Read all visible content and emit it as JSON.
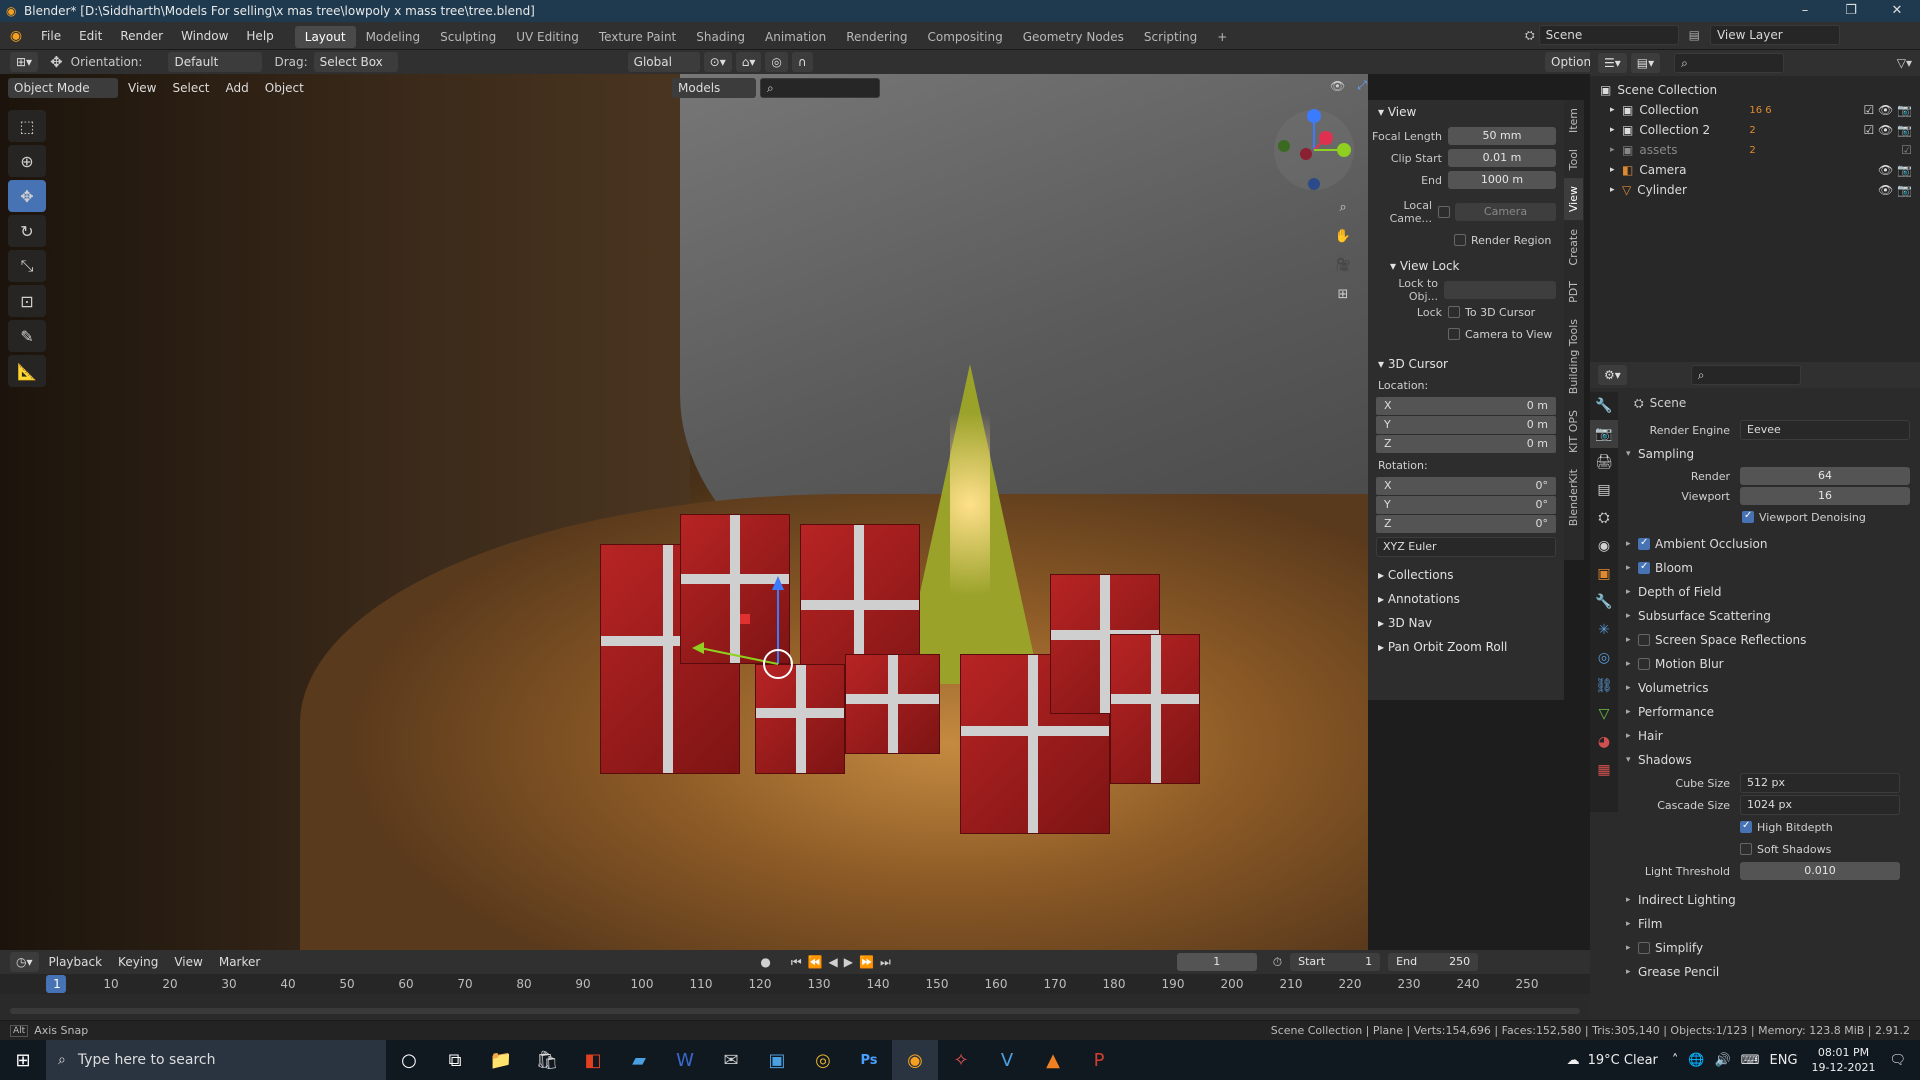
{
  "window": {
    "title": "Blender* [D:\\Siddharth\\Models For selling\\x mas tree\\lowpoly x mass tree\\tree.blend]",
    "controls": [
      "–",
      "❐",
      "✕"
    ]
  },
  "menubar": {
    "menus": [
      "File",
      "Edit",
      "Render",
      "Window",
      "Help"
    ],
    "workspaces": [
      "Layout",
      "Modeling",
      "Sculpting",
      "UV Editing",
      "Texture Paint",
      "Shading",
      "Animation",
      "Rendering",
      "Compositing",
      "Geometry Nodes",
      "Scripting",
      "+"
    ],
    "active_workspace": "Layout",
    "scene": "Scene",
    "view_layer": "View Layer"
  },
  "toolheader": {
    "orientation_label": "Orientation:",
    "orientation_value": "Default",
    "drag_label": "Drag:",
    "drag_value": "Select Box",
    "transform_space": "Global",
    "options": "Options"
  },
  "viewport_header": {
    "mode": "Object Mode",
    "menus": [
      "View",
      "Select",
      "Add",
      "Object"
    ],
    "collection_filter": "Models"
  },
  "npanel": {
    "tabs": [
      "Item",
      "Tool",
      "View",
      "Create",
      "PDT",
      "Building Tools",
      "KIT OPS",
      "BlenderKit"
    ],
    "active_tab": "View",
    "view": {
      "header": "View",
      "focal_length_label": "Focal Length",
      "focal_length": "50 mm",
      "clip_start_label": "Clip Start",
      "clip_start": "0.01 m",
      "end_label": "End",
      "end": "1000 m",
      "local_camera_label": "Local Came...",
      "local_camera_value": "Camera",
      "render_region": "Render Region"
    },
    "view_lock": {
      "header": "View Lock",
      "lock_to_obj_label": "Lock to Obj...",
      "lock_label": "Lock",
      "to_3d_cursor": "To 3D Cursor",
      "camera_to_view": "Camera to View"
    },
    "cursor": {
      "header": "3D Cursor",
      "location_label": "Location:",
      "loc": [
        {
          "axis": "X",
          "value": "0 m"
        },
        {
          "axis": "Y",
          "value": "0 m"
        },
        {
          "axis": "Z",
          "value": "0 m"
        }
      ],
      "rotation_label": "Rotation:",
      "rot": [
        {
          "axis": "X",
          "value": "0°"
        },
        {
          "axis": "Y",
          "value": "0°"
        },
        {
          "axis": "Z",
          "value": "0°"
        }
      ],
      "rotation_mode": "XYZ Euler"
    },
    "collapsed": [
      "Collections",
      "Annotations",
      "3D Nav",
      "Pan Orbit Zoom Roll"
    ]
  },
  "outliner": {
    "root": "Scene Collection",
    "items": [
      {
        "name": "Collection",
        "badges": "16 6"
      },
      {
        "name": "Collection 2",
        "badges": "2"
      },
      {
        "name": "assets",
        "badges": "2"
      },
      {
        "name": "Camera",
        "badges": ""
      },
      {
        "name": "Cylinder",
        "badges": ""
      }
    ]
  },
  "properties": {
    "scene_label": "Scene",
    "render_engine_label": "Render Engine",
    "render_engine": "Eevee",
    "sampling": {
      "header": "Sampling",
      "render_label": "Render",
      "render": "64",
      "viewport_label": "Viewport",
      "viewport": "16",
      "denoise": "Viewport Denoising"
    },
    "sections": [
      {
        "label": "Ambient Occlusion",
        "check": true
      },
      {
        "label": "Bloom",
        "check": true
      },
      {
        "label": "Depth of Field",
        "check": null
      },
      {
        "label": "Subsurface Scattering",
        "check": null
      },
      {
        "label": "Screen Space Reflections",
        "check": false
      },
      {
        "label": "Motion Blur",
        "check": false
      },
      {
        "label": "Volumetrics",
        "check": null
      },
      {
        "label": "Performance",
        "check": null
      },
      {
        "label": "Hair",
        "check": null
      }
    ],
    "shadows": {
      "header": "Shadows",
      "cube_size_label": "Cube Size",
      "cube_size": "512 px",
      "cascade_size_label": "Cascade Size",
      "cascade_size": "1024 px",
      "high_bitdepth": "High Bitdepth",
      "soft_shadows": "Soft Shadows",
      "light_threshold_label": "Light Threshold",
      "light_threshold": "0.010"
    },
    "more_sections": [
      {
        "label": "Indirect Lighting",
        "check": null
      },
      {
        "label": "Film",
        "check": null
      },
      {
        "label": "Simplify",
        "check": false
      },
      {
        "label": "Grease Pencil",
        "check": null
      }
    ]
  },
  "timeline": {
    "menus": [
      "Playback",
      "Keying",
      "View",
      "Marker"
    ],
    "current_frame": "1",
    "start_label": "Start",
    "start": "1",
    "end_label": "End",
    "end": "250",
    "ticks": [
      "1",
      "10",
      "20",
      "30",
      "40",
      "50",
      "60",
      "70",
      "80",
      "90",
      "100",
      "110",
      "120",
      "130",
      "140",
      "150",
      "160",
      "170",
      "180",
      "190",
      "200",
      "210",
      "220",
      "230",
      "240",
      "250"
    ]
  },
  "statusbar": {
    "left": "Axis Snap",
    "right": "Scene Collection | Plane | Verts:154,696 | Faces:152,580 | Tris:305,140 | Objects:1/123 | Memory: 123.8 MiB | 2.91.2"
  },
  "taskbar": {
    "search_placeholder": "Type here to search",
    "weather": "19°C  Clear",
    "language": "ENG",
    "time": "08:01 PM",
    "date": "19-12-2021"
  }
}
